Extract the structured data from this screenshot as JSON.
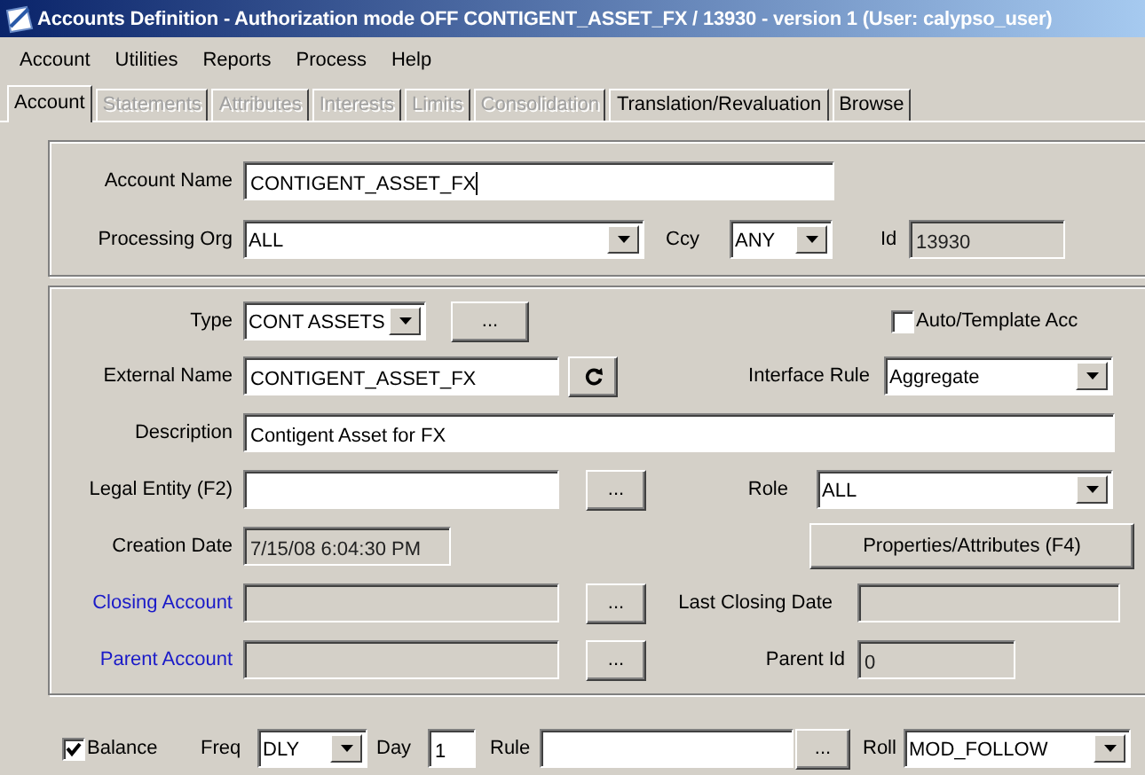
{
  "window": {
    "title": "Accounts Definition - Authorization mode OFF CONTIGENT_ASSET_FX / 13930 - version 1 (User: calypso_user)"
  },
  "menu": [
    "Account",
    "Utilities",
    "Reports",
    "Process",
    "Help"
  ],
  "tabs": [
    {
      "label": "Account",
      "selected": true,
      "disabled": false
    },
    {
      "label": "Statements",
      "selected": false,
      "disabled": true
    },
    {
      "label": "Attributes",
      "selected": false,
      "disabled": true
    },
    {
      "label": "Interests",
      "selected": false,
      "disabled": true
    },
    {
      "label": "Limits",
      "selected": false,
      "disabled": true
    },
    {
      "label": "Consolidation",
      "selected": false,
      "disabled": true
    },
    {
      "label": "Translation/Revaluation",
      "selected": false,
      "disabled": false
    },
    {
      "label": "Browse",
      "selected": false,
      "disabled": false
    }
  ],
  "header": {
    "account_name": {
      "label": "Account Name",
      "value": "CONTIGENT_ASSET_FX",
      "disabled": false
    },
    "processing_org": {
      "label": "Processing Org",
      "value": "ALL"
    },
    "ccy": {
      "label": "Ccy",
      "value": "ANY"
    },
    "id": {
      "label": "Id",
      "value": "13930",
      "disabled": true
    }
  },
  "details": {
    "type": {
      "label": "Type",
      "value": "CONT ASSETS"
    },
    "type_button": "...",
    "auto_template": {
      "label": "Auto/Template Acc",
      "checked": false
    },
    "external_name": {
      "label": "External Name",
      "value": "CONTIGENT_ASSET_FX",
      "disabled": false
    },
    "interface_rule": {
      "label": "Interface Rule",
      "value": "Aggregate"
    },
    "description": {
      "label": "Description",
      "value": "Contigent Asset for FX",
      "disabled": false
    },
    "legal_entity": {
      "label": "Legal Entity (F2)",
      "disabled": false
    },
    "legal_entity_button": "...",
    "role": {
      "label": "Role",
      "value": "ALL"
    },
    "creation_date": {
      "label": "Creation Date",
      "value": "7/15/08 6:04:30 PM",
      "disabled": true
    },
    "properties_button": "Properties/Attributes (F4)",
    "closing_account": {
      "label": "Closing Account",
      "link": true,
      "disabled": true
    },
    "closing_account_button": "...",
    "last_closing_date": {
      "label": "Last Closing Date",
      "disabled": true
    },
    "parent_account": {
      "label": "Parent Account",
      "link": true,
      "disabled": true
    },
    "parent_account_button": "...",
    "parent_id": {
      "label": "Parent Id",
      "value": "0",
      "disabled": true
    }
  },
  "balance": {
    "checkbox": {
      "label": "Balance",
      "checked": true
    },
    "freq": {
      "label": "Freq",
      "value": "DLY"
    },
    "day": {
      "label": "Day",
      "value": "1",
      "disabled": false
    },
    "rule": {
      "label": "Rule",
      "disabled": false
    },
    "rule_button": "...",
    "roll": {
      "label": "Roll",
      "value": "MOD_FOLLOW"
    }
  }
}
